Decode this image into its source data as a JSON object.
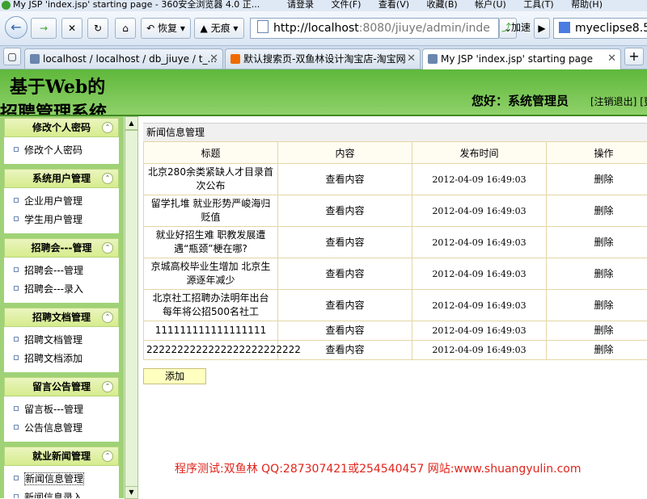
{
  "window": {
    "title": "My JSP 'index.jsp' starting page - 360安全浏览器 4.0 正...",
    "menus": [
      "请登录",
      "文件(F)",
      "查看(V)",
      "收藏(B)",
      "帐户(U)",
      "工具(T)",
      "帮助(H)"
    ]
  },
  "toolbar": {
    "back_icon": "arrow-left-icon",
    "forward_icon": "arrow-right-icon",
    "restore_label": "恢复",
    "incognito_label": "无痕",
    "address_host": "http://localhost",
    "address_rest": ":8080/jiuye/admin/inde",
    "accelerate_label": "加速",
    "search_value": "myeclipse8.5"
  },
  "tabs": [
    {
      "label": "localhost / localhost / db_jiuye / t_...",
      "active": false
    },
    {
      "label": "默认搜索页-双鱼林设计淘宝店-淘宝网",
      "active": false
    },
    {
      "label": "My JSP 'index.jsp' starting page",
      "active": true
    }
  ],
  "header": {
    "logo_line1": "基于Web的",
    "logo_line2": "招聘管理系统",
    "greeting": "您好：系统管理员",
    "logout_link": "[注销退出]",
    "more_link": "[更"
  },
  "sidebar": {
    "groups": [
      {
        "title": "修改个人密码",
        "items": [
          "修改个人密码"
        ]
      },
      {
        "title": "系统用户管理",
        "items": [
          "企业用户管理",
          "学生用户管理"
        ]
      },
      {
        "title": "招聘会---管理",
        "items": [
          "招聘会---管理",
          "招聘会---录入"
        ]
      },
      {
        "title": "招聘文档管理",
        "items": [
          "招聘文档管理",
          "招聘文档添加"
        ]
      },
      {
        "title": "留言公告管理",
        "items": [
          "留言板---管理",
          "公告信息管理"
        ]
      },
      {
        "title": "就业新闻管理",
        "items": [
          "新闻信息管理",
          "新闻信息录入"
        ]
      }
    ]
  },
  "main": {
    "panel_title": "新闻信息管理",
    "columns": [
      "标题",
      "内容",
      "发布时间",
      "操作"
    ],
    "rows": [
      {
        "title": "北京280余类紧缺人才目录首次公布",
        "content": "查看内容",
        "time": "2012-04-09 16:49:03",
        "action": "删除"
      },
      {
        "title": "留学扎堆 就业形势严峻海归贬值",
        "content": "查看内容",
        "time": "2012-04-09 16:49:03",
        "action": "删除"
      },
      {
        "title": "就业好招生难 职教发展遭遇“瓶颈”梗在哪?",
        "content": "查看内容",
        "time": "2012-04-09 16:49:03",
        "action": "删除"
      },
      {
        "title": "京城高校毕业生增加 北京生源逐年减少",
        "content": "查看内容",
        "time": "2012-04-09 16:49:03",
        "action": "删除"
      },
      {
        "title": "北京社工招聘办法明年出台 每年将公招500名社工",
        "content": "查看内容",
        "time": "2012-04-09 16:49:03",
        "action": "删除"
      },
      {
        "title": "111111111111111111",
        "content": "查看内容",
        "time": "2012-04-09 16:49:03",
        "action": "删除"
      },
      {
        "title": "2222222222222222222222222",
        "content": "查看内容",
        "time": "2012-04-09 16:49:03",
        "action": "删除"
      }
    ],
    "add_label": "添加"
  },
  "footer": {
    "credit": "程序测试:双鱼林 QQ:287307421或254540457 网站:www.shuangyulin.com"
  },
  "colors": {
    "header_green": "#5fb83b",
    "sidebar_green": "#9fd276",
    "credit_red": "#e0241b"
  }
}
